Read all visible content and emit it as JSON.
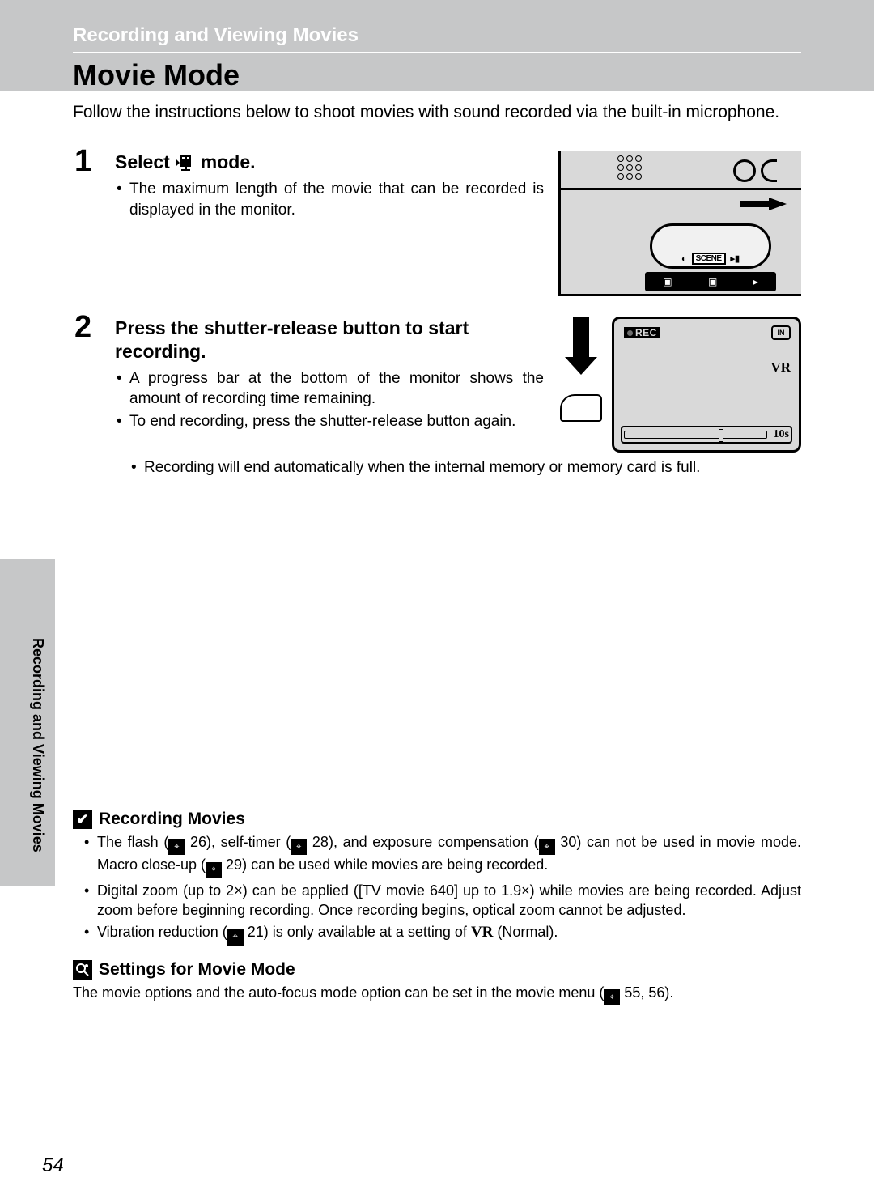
{
  "section_label": "Recording and Viewing Movies",
  "page_title": "Movie Mode",
  "intro": "Follow the instructions below to shoot movies with sound recorded via the built-in microphone.",
  "steps": [
    {
      "num": "1",
      "heading_before": "Select",
      "heading_after": "mode.",
      "bullets": [
        "The maximum length of the movie that can be recorded is displayed in the monitor."
      ]
    },
    {
      "num": "2",
      "heading": "Press the shutter-release button to start recording.",
      "bullets_narrow": [
        "A progress bar at the bottom of the monitor shows the amount of recording time remaining.",
        "To end recording, press the shutter-release button again."
      ],
      "bullets_wide": [
        "Recording will end automatically when the internal memory or memory card is full."
      ]
    }
  ],
  "monitor": {
    "rec_label": "REC",
    "in_label": "IN",
    "vr_label": "VR",
    "time_remaining": "10s"
  },
  "dial_scene": "SCENE",
  "side_tab_label": "Recording and Viewing Movies",
  "notes": {
    "n1_title": "Recording Movies",
    "n1_b1_a": "The flash (",
    "n1_b1_b": " 26), self-timer (",
    "n1_b1_c": " 28), and exposure compensation (",
    "n1_b1_d": " 30) can not be used in movie mode. Macro close-up (",
    "n1_b1_e": " 29) can be used while movies are being recorded.",
    "n1_b2": "Digital zoom (up to 2×) can be applied ([TV movie 640] up to 1.9×) while movies are being recorded. Adjust zoom before beginning recording. Once recording begins, optical zoom cannot be adjusted.",
    "n1_b3_a": "Vibration reduction (",
    "n1_b3_b": " 21) is only available at a setting of ",
    "n1_b3_c": " (Normal).",
    "n2_title": "Settings for Movie Mode",
    "n2_text_a": "The movie options and the auto-focus mode option can be set in the movie menu (",
    "n2_text_b": " 55, 56)."
  },
  "page_number": "54",
  "ref_glyph": "⌖"
}
